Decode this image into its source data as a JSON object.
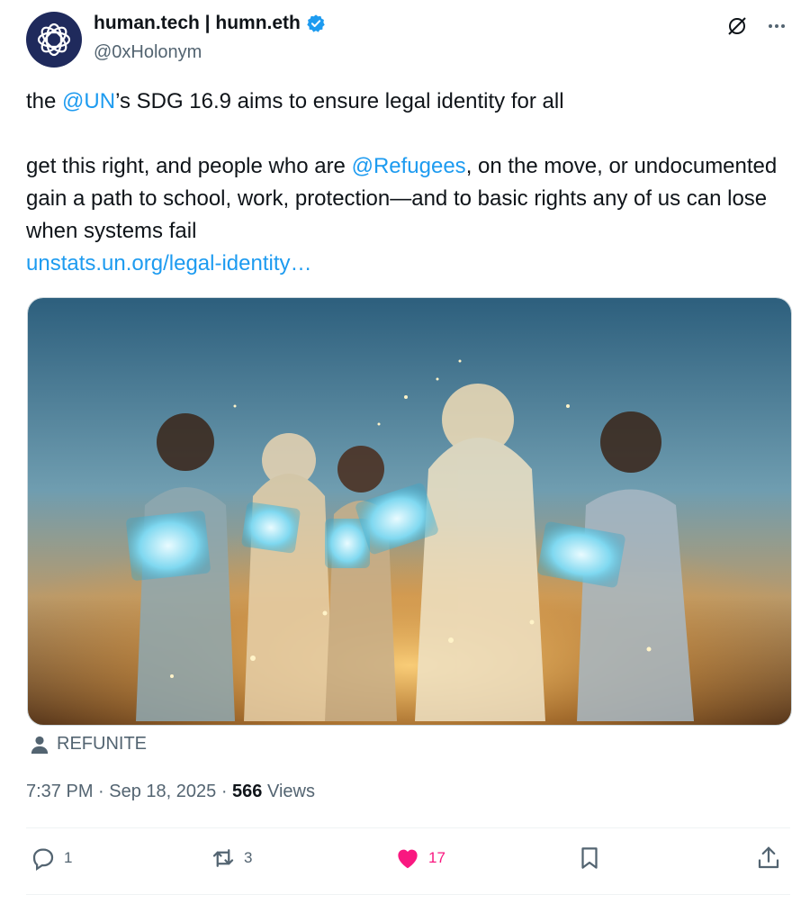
{
  "author": {
    "name": "human.tech | humn.eth",
    "handle": "@0xHolonym"
  },
  "tweet": {
    "line1_pre": "the ",
    "line1_mention": "@UN",
    "line1_post": "’s SDG 16.9 aims to ensure legal identity for all",
    "line2_pre": "get this right, and people who are ",
    "line2_mention": "@Refugees",
    "line2_post": ", on the move, or undocumented gain a path to school, work, protection—and to basic rights any of us can lose when systems fail",
    "link": "unstats.un.org/legal-identity…"
  },
  "media": {
    "attribution": "REFUNITE"
  },
  "meta": {
    "time": "7:37 PM",
    "sep1": " · ",
    "date": "Sep 18, 2025",
    "sep2": " · ",
    "views_count": "566",
    "views_label": " Views"
  },
  "actions": {
    "replies": "1",
    "reposts": "3",
    "likes": "17"
  },
  "colors": {
    "link": "#1d9bf0",
    "muted": "#536471",
    "like": "#f91880",
    "verified": "#1d9bf0"
  },
  "icons": [
    "globe-logo-icon",
    "verified-badge-icon",
    "grok-icon",
    "more-icon",
    "person-icon",
    "reply-icon",
    "repost-icon",
    "heart-filled-icon",
    "bookmark-icon",
    "share-icon"
  ]
}
